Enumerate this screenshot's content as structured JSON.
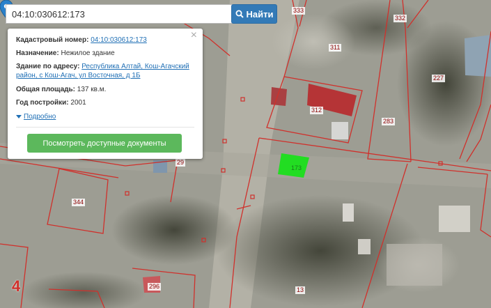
{
  "search": {
    "value": "04:10:030612:173",
    "button_label": "Найти"
  },
  "popup": {
    "cadastral_label": "Кадастровый номер:",
    "cadastral_value": "04:10:030612:173",
    "purpose_label": "Назначение:",
    "purpose_value": "Нежилое здание",
    "address_label": "Здание по адресу:",
    "address_line1": "Республика Алтай, Кош-Агачский",
    "address_line2": "район, с Кош-Агач, ул Восточная, д 1Б",
    "area_label": "Общая площадь:",
    "area_value": "137 кв.м.",
    "year_label": "Год постройки:",
    "year_value": "2001",
    "more_label": "Подробно",
    "docs_button": "Посмотреть доступные документы",
    "close_icon": "close-icon"
  },
  "map": {
    "plot_labels": [
      "333",
      "332",
      "311",
      "227",
      "312",
      "283",
      "344",
      "296",
      "13",
      "173",
      "29"
    ],
    "zone_digit": "4",
    "marker_icon": "map-pin-icon",
    "colors": {
      "boundary": "#d0302b",
      "selected": "#22dd22",
      "button": "#337ab7",
      "docs": "#5cb85c"
    }
  }
}
